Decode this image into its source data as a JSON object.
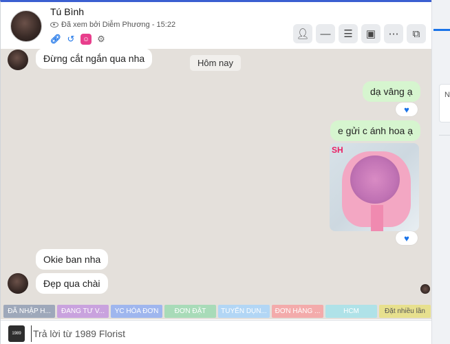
{
  "header": {
    "name": "Tú Bình",
    "seen_text": "Đã xem bởi Diễm Phương - 15:22"
  },
  "side_panel": {
    "card_text": "N"
  },
  "messages": {
    "date_divider": "Hôm nay",
    "items": [
      {
        "text": "Đừng cắt ngắn qua nha",
        "direction": "in"
      },
      {
        "text": "dạ vâng ạ",
        "direction": "out",
        "reaction": "heart"
      },
      {
        "text": "e gửi c ánh hoa ạ",
        "direction": "out"
      },
      {
        "image": "pink-flower-bouquet",
        "image_logo_text": "SH",
        "direction": "out",
        "reaction": "heart"
      },
      {
        "text": "Okie ban nha",
        "direction": "in"
      },
      {
        "text": "Đẹp qua chài",
        "direction": "in"
      }
    ]
  },
  "tags": [
    {
      "label": "ĐÃ NHẬP H...",
      "color": "#9ea8ba"
    },
    {
      "label": "ĐANG TƯ V...",
      "color": "#c9a2de"
    },
    {
      "label": "YC HÓA ĐƠN",
      "color": "#9fb6ee"
    },
    {
      "label": "ĐƠN ĐẶT",
      "color": "#a8dbb8"
    },
    {
      "label": "TUYỂN DỤN...",
      "color": "#b2d6f5"
    },
    {
      "label": "ĐƠN HÀNG ...",
      "color": "#f3abab"
    },
    {
      "label": "HCM",
      "color": "#afe2e8"
    },
    {
      "label": "Đặt nhiều lần",
      "color": "#e7e08e"
    }
  ],
  "composer": {
    "placeholder": "Trả lời từ 1989 Florist",
    "logo_text": "1989"
  },
  "icons": {
    "header_actions": [
      "add-user-icon",
      "minimize-icon",
      "checklist-icon",
      "inbox-icon",
      "more-icon",
      "open-external-icon"
    ],
    "meta_icons": [
      "link-icon",
      "history-icon",
      "pink-face-icon",
      "robot-icon"
    ],
    "reaction": "heart-icon"
  }
}
